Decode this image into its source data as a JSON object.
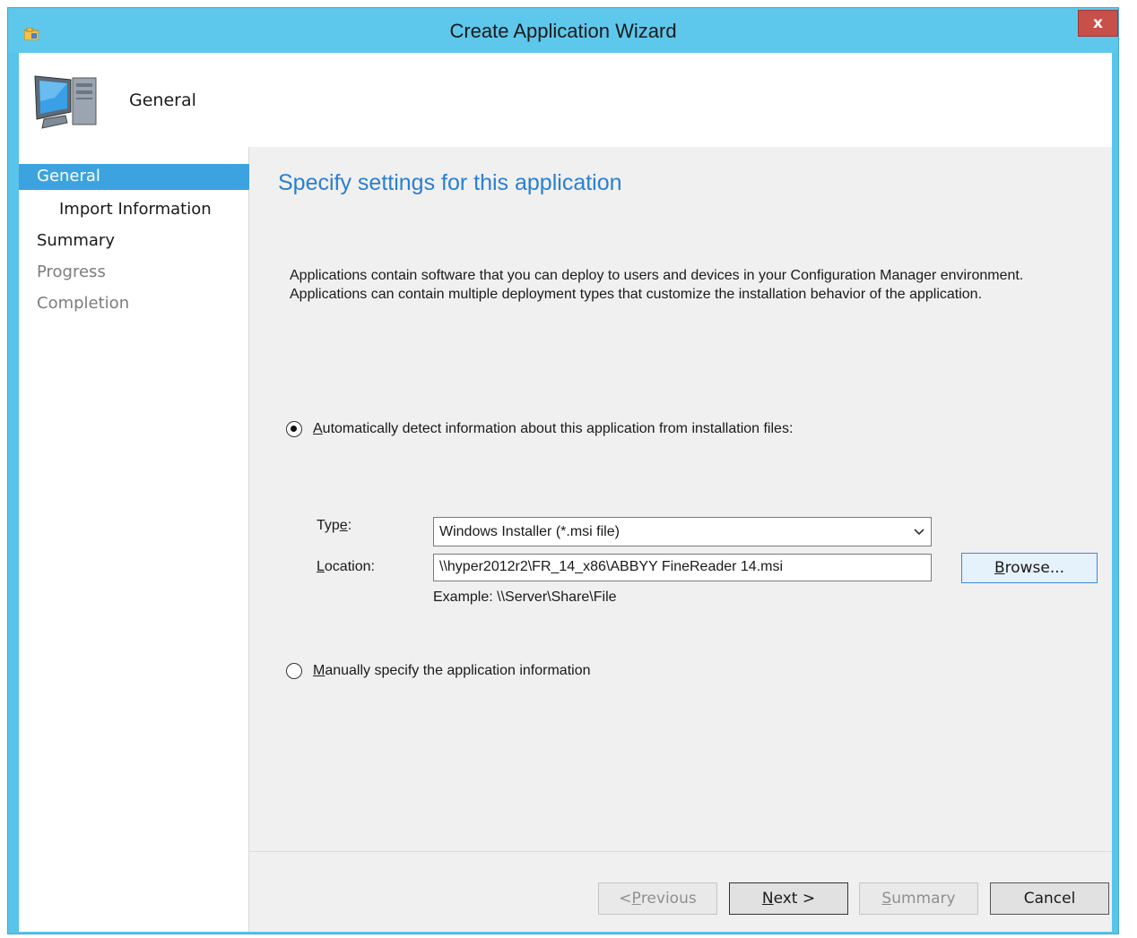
{
  "window": {
    "title": "Create Application Wizard",
    "close_label": "x"
  },
  "header": {
    "title": "General",
    "icon": "computer-icon"
  },
  "nav": {
    "items": [
      {
        "label": "General",
        "state": "active"
      },
      {
        "label": "Import Information",
        "state": "normal"
      },
      {
        "label": "Summary",
        "state": "normal"
      },
      {
        "label": "Progress",
        "state": "disabled"
      },
      {
        "label": "Completion",
        "state": "disabled"
      }
    ]
  },
  "main": {
    "heading": "Specify settings for this application",
    "description_line1": "Applications contain software that you can deploy to users and devices in your Configuration Manager environment.",
    "description_line2": "Applications can contain multiple deployment types that customize the installation behavior of the application.",
    "auto_detect": {
      "label_first": "A",
      "label_rest": "utomatically detect information about this application from installation files:",
      "checked": true
    },
    "type_field": {
      "label_pre": "Typ",
      "label_accel": "e",
      "label_post": ":",
      "value": "Windows Installer (*.msi file)"
    },
    "location_field": {
      "label_accel": "L",
      "label_rest": "ocation:",
      "value": "\\\\hyper2012r2\\FR_14_x86\\ABBYY FineReader 14.msi"
    },
    "browse": {
      "accel": "B",
      "rest": "rowse..."
    },
    "example": "Example: \\\\Server\\Share\\File",
    "manual": {
      "label_first": "M",
      "label_rest": "anually specify the application information",
      "checked": false
    }
  },
  "footer": {
    "previous": {
      "pre": "< ",
      "accel": "P",
      "rest": "revious"
    },
    "next": {
      "accel": "N",
      "rest": "ext >"
    },
    "summary": {
      "accel": "S",
      "rest": "ummary"
    },
    "cancel": "Cancel"
  },
  "colors": {
    "titlebar": "#5ec7ec",
    "accent": "#3ca3e0",
    "heading": "#2a7fce",
    "close": "#c7504a"
  }
}
